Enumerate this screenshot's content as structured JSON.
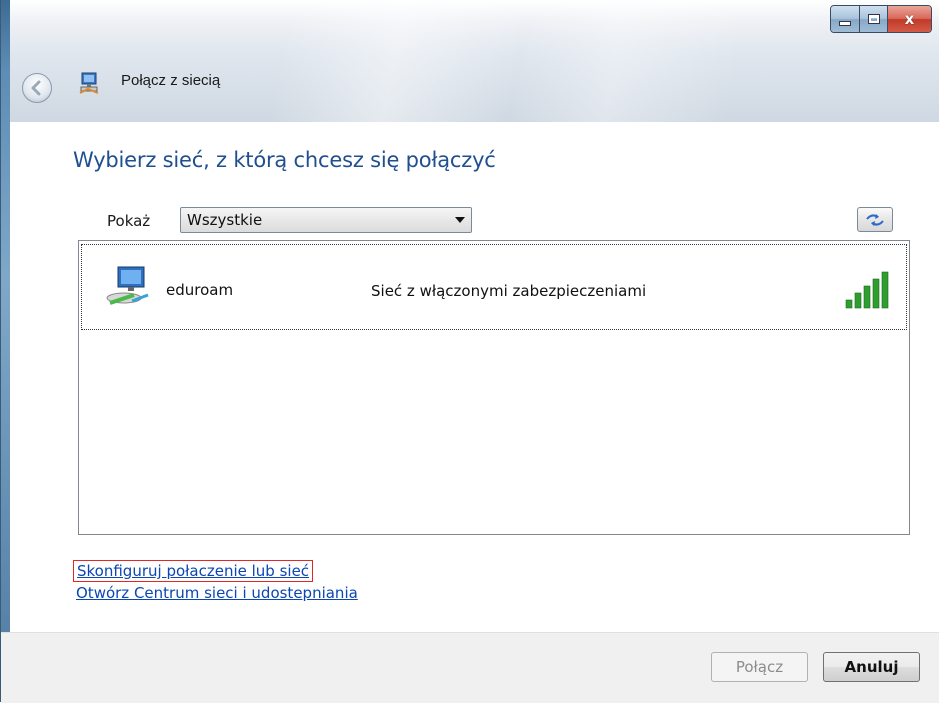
{
  "window": {
    "title": "Połącz z siecią",
    "caption_buttons": {
      "close": "x"
    }
  },
  "main": {
    "heading": "Wybierz sieć, z którą chcesz się połączyć",
    "filter": {
      "label": "Pokaż",
      "selected": "Wszystkie"
    },
    "networks": [
      {
        "ssid": "eduroam",
        "security": "Sieć z włączonymi zabezpieczeniami",
        "signal_bars": 5,
        "signal_level": 1.0
      }
    ]
  },
  "links": {
    "setup": "Skonfiguruj połaczenie lub sieć",
    "network_center": "Otwórz Centrum sieci i udostepniania"
  },
  "footer": {
    "connect_label": "Połącz",
    "cancel_label": "Anuluj"
  },
  "colors": {
    "heading": "#1f4f8f",
    "link": "#0a46b4",
    "signal": "#2e9e2e",
    "highlight_border": "#e02828"
  },
  "icons": {
    "back": "back-arrow-icon",
    "title": "network-connection-icon",
    "refresh": "refresh-icon",
    "network": "wireless-computer-icon",
    "signal": "signal-strength-icon"
  }
}
